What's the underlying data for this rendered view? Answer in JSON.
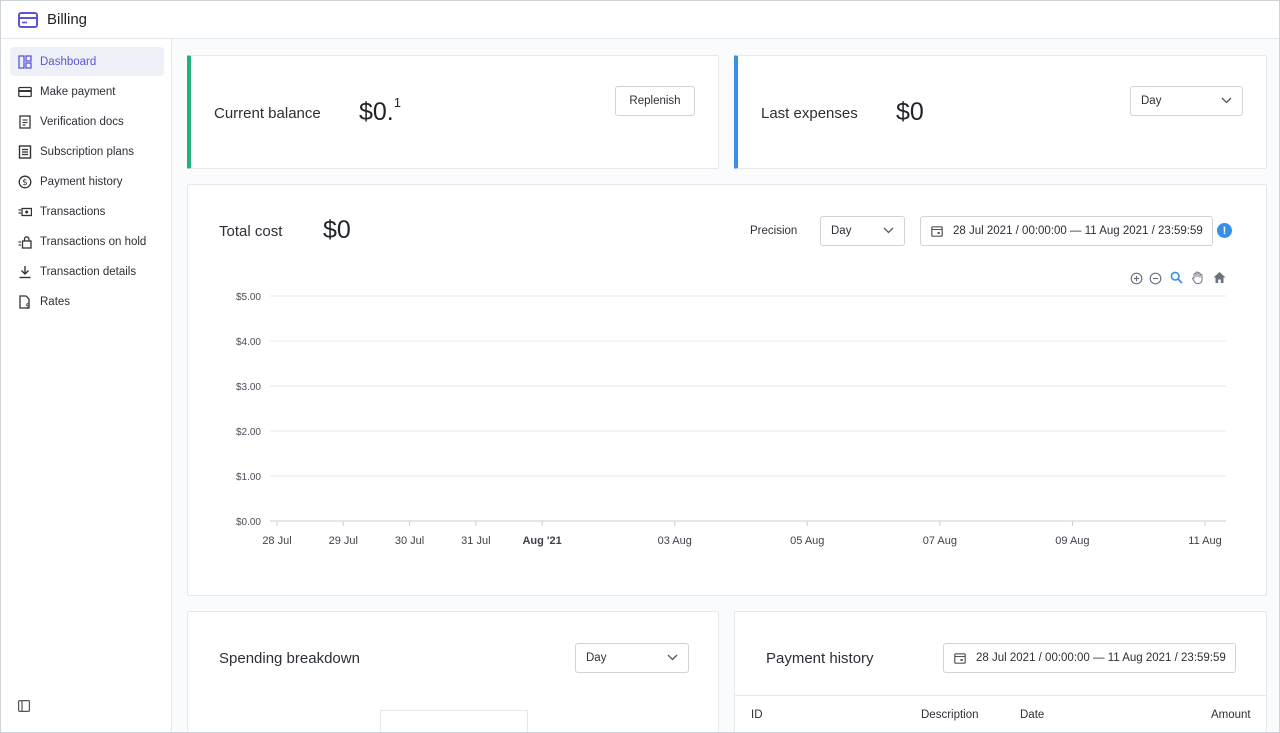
{
  "app": {
    "title": "Billing",
    "accent": "#5b55d6"
  },
  "sidebar": {
    "items": [
      {
        "label": "Dashboard",
        "icon": "dashboard-icon",
        "active": true
      },
      {
        "label": "Make payment",
        "icon": "card-icon"
      },
      {
        "label": "Verification docs",
        "icon": "document-icon"
      },
      {
        "label": "Subscription plans",
        "icon": "list-icon"
      },
      {
        "label": "Payment history",
        "icon": "dollar-circle-icon"
      },
      {
        "label": "Transactions",
        "icon": "transactions-icon"
      },
      {
        "label": "Transactions on hold",
        "icon": "lock-icon"
      },
      {
        "label": "Transaction details",
        "icon": "download-icon"
      },
      {
        "label": "Rates",
        "icon": "rates-file-icon"
      }
    ]
  },
  "balance": {
    "title": "Current balance",
    "currency": "$",
    "amount": "0.",
    "superscript": "1",
    "replenish_label": "Replenish",
    "accent": "#22b07d"
  },
  "expenses": {
    "title": "Last expenses",
    "currency": "$",
    "amount": "0",
    "period": "Day",
    "accent": "#3a8ee6"
  },
  "total_cost": {
    "title": "Total cost",
    "currency": "$",
    "amount": "0",
    "precision_label": "Precision",
    "precision_value": "Day",
    "date_range": "28 Jul 2021 / 00:00:00 — 11 Aug 2021 / 23:59:59",
    "info_symbol": "!"
  },
  "chart_data": {
    "type": "line",
    "title": "",
    "xlabel": "",
    "ylabel": "",
    "ylim": [
      0,
      5
    ],
    "y_ticks": [
      "$0.00",
      "$1.00",
      "$2.00",
      "$3.00",
      "$4.00",
      "$5.00"
    ],
    "x_ticks": [
      {
        "label": "28 Jul",
        "day": 0,
        "bold": false
      },
      {
        "label": "29 Jul",
        "day": 1,
        "bold": false
      },
      {
        "label": "30 Jul",
        "day": 2,
        "bold": false
      },
      {
        "label": "31 Jul",
        "day": 3,
        "bold": false
      },
      {
        "label": "Aug '21",
        "day": 4,
        "bold": true
      },
      {
        "label": "03 Aug",
        "day": 6,
        "bold": false
      },
      {
        "label": "05 Aug",
        "day": 8,
        "bold": false
      },
      {
        "label": "07 Aug",
        "day": 10,
        "bold": false
      },
      {
        "label": "09 Aug",
        "day": 12,
        "bold": false
      },
      {
        "label": "11 Aug",
        "day": 14,
        "bold": false
      }
    ],
    "grid": true,
    "series": []
  },
  "spending": {
    "title": "Spending breakdown",
    "period": "Day"
  },
  "payment_history": {
    "title": "Payment history",
    "date_range": "28 Jul 2021 / 00:00:00 — 11 Aug 2021 / 23:59:59",
    "columns": [
      "ID",
      "Description",
      "Date",
      "Amount"
    ]
  }
}
